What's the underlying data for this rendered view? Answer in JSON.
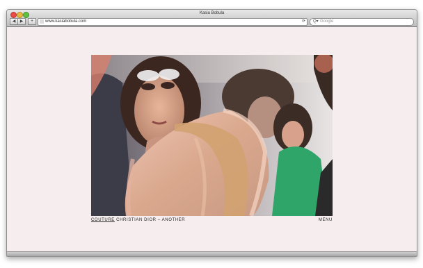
{
  "window": {
    "title": "Kasia Bobula"
  },
  "toolbar": {
    "back_label": "◀",
    "forward_label": "▶",
    "add_label": "+",
    "url": "www.kasiabobula.com",
    "reload_label": "⟳",
    "search_placeholder": "Google",
    "search_glyph": "Q▾"
  },
  "gallery": {
    "category": "COUTURE",
    "caption_rest": " CHRISTIAN DIOR – ANOTHER",
    "menu_label": "MENU"
  },
  "colors": {
    "page_bg": "#f6eeee",
    "caption": "#222222"
  },
  "icons": {
    "back": "back-arrow-icon",
    "forward": "forward-arrow-icon",
    "reload": "reload-icon",
    "search": "search-icon"
  }
}
